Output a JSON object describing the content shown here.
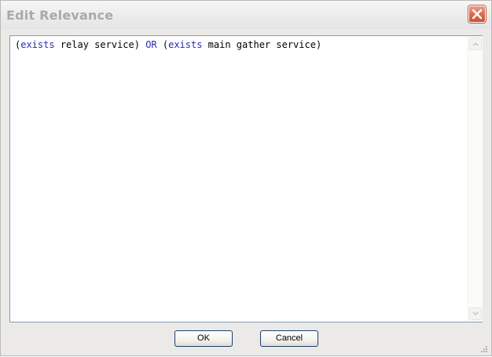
{
  "window": {
    "title": "Edit Relevance"
  },
  "editor": {
    "tokens": [
      {
        "text": "(",
        "kind": "plain"
      },
      {
        "text": "exists",
        "kind": "keyword"
      },
      {
        "text": " relay service) ",
        "kind": "plain"
      },
      {
        "text": "OR",
        "kind": "keyword"
      },
      {
        "text": " (",
        "kind": "plain"
      },
      {
        "text": "exists",
        "kind": "keyword"
      },
      {
        "text": " main gather service)",
        "kind": "plain"
      }
    ]
  },
  "buttons": {
    "ok_label": "OK",
    "cancel_label": "Cancel"
  },
  "colors": {
    "keyword": "#2a2ab8",
    "title_text": "#a9a9a9",
    "close_button": "#d8694b",
    "editor_border": "#7f9db9",
    "button_border": "#1c3d6e"
  },
  "icons": {
    "close": "close-icon",
    "scroll_up": "scroll-up-arrow-icon",
    "scroll_down": "scroll-down-arrow-icon",
    "resize": "resize-grip-icon"
  }
}
